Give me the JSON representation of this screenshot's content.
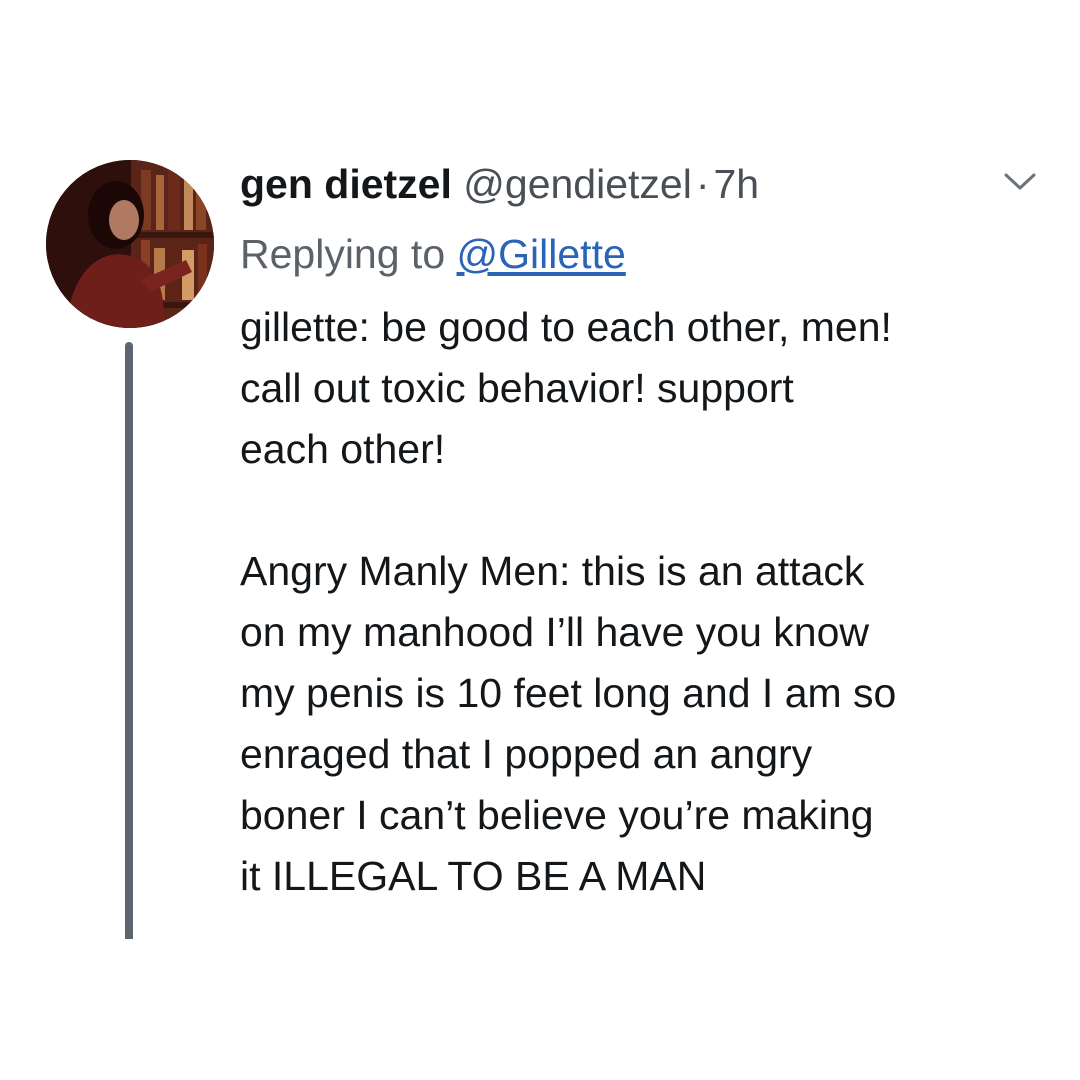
{
  "author": {
    "display_name": "gen dietzel",
    "handle": "@gendietzel",
    "separator": "·",
    "time": "7h"
  },
  "reply": {
    "prefix": "Replying to",
    "target": "@Gillette"
  },
  "tweet": {
    "paragraph1": [
      "gillette: be good to each other, men!",
      "call out toxic behavior! support",
      "each other!"
    ],
    "paragraph2": [
      "Angry Manly Men: this is an attack",
      "on my manhood I’ll have you know",
      "my penis is 10 feet long and I am so",
      "enraged that I popped an angry",
      "boner I can’t believe you’re making",
      "it ILLEGAL TO BE A MAN"
    ]
  },
  "icons": {
    "menu": "chevron-down-icon"
  },
  "colors": {
    "link": "#2a64b8",
    "thread_line": "#5c6570",
    "secondary_text": "#5b6168"
  }
}
